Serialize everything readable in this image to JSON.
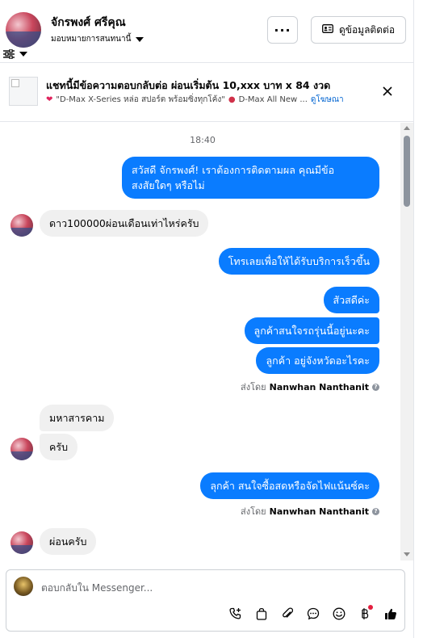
{
  "header": {
    "contact_name": "จักรพงศ์ ศรีคุณ",
    "assignee_label": "มอบหมายการสนทนานี้",
    "more_label": "···",
    "contact_info_label": "ดูข้อมูลติดต่อ"
  },
  "ad_banner": {
    "title": "แชทนี้มีข้อความตอบกลับต่อ ผ่อนเริ่มต้น 10,xxx บาท x 84 งวด",
    "ad_text_1": "\"D-Max X-Series หล่อ สปอร์ต พร้อมซิ่งทุกโค้ง\"",
    "ad_text_2": "D-Max All New ...",
    "view_ad_link": "ดูโฆษณา"
  },
  "conversation": {
    "timestamp": "18:40",
    "messages": [
      {
        "text_line1": "สวัสดี จักรพงศ์! เราต้องการติดตามผล คุณมีข้อ",
        "text_line2": "สงสัยใดๆ หรือไม่"
      },
      {
        "text": "ดาว100000ผ่อนเดือนเท่าไหร่ครับ"
      },
      {
        "text": "โทรเลยเพื่อให้ได้รับบริการเร็วขึ้น"
      },
      {
        "text": "สัวสดีค่ะ"
      },
      {
        "text": "ลูกค้าสนใจรถรุ่นนี้อยู่นะคะ"
      },
      {
        "text": "ลูกค้า  อยู่จังหวัดอะไรคะ"
      },
      {
        "text": "มหาสารคาม"
      },
      {
        "text": "ครับ"
      },
      {
        "text": "ลุกค้า  สนใจซื้อสดหรือจัดไฟแน้นซ์คะ"
      },
      {
        "text": "ผ่อนครับ"
      }
    ],
    "sent_by_prefix": "ส่งโดย",
    "sent_by_name": "Nanwhan Nanthanit"
  },
  "composer": {
    "placeholder": "ตอบกลับใน Messenger..."
  },
  "icons": [
    "settings-sliders-icon",
    "caret-down-icon",
    "contact-card-icon",
    "close-icon",
    "info-icon",
    "call-icon",
    "shopping-bag-icon",
    "attachment-icon",
    "saved-replies-icon",
    "emoji-icon",
    "payment-icon",
    "thumbs-up-icon"
  ],
  "colors": {
    "outgoing_bubble": "#0a7cff",
    "incoming_bubble": "#f0f0f0",
    "link": "#0064d1",
    "notification_dot": "#e41e3f"
  }
}
